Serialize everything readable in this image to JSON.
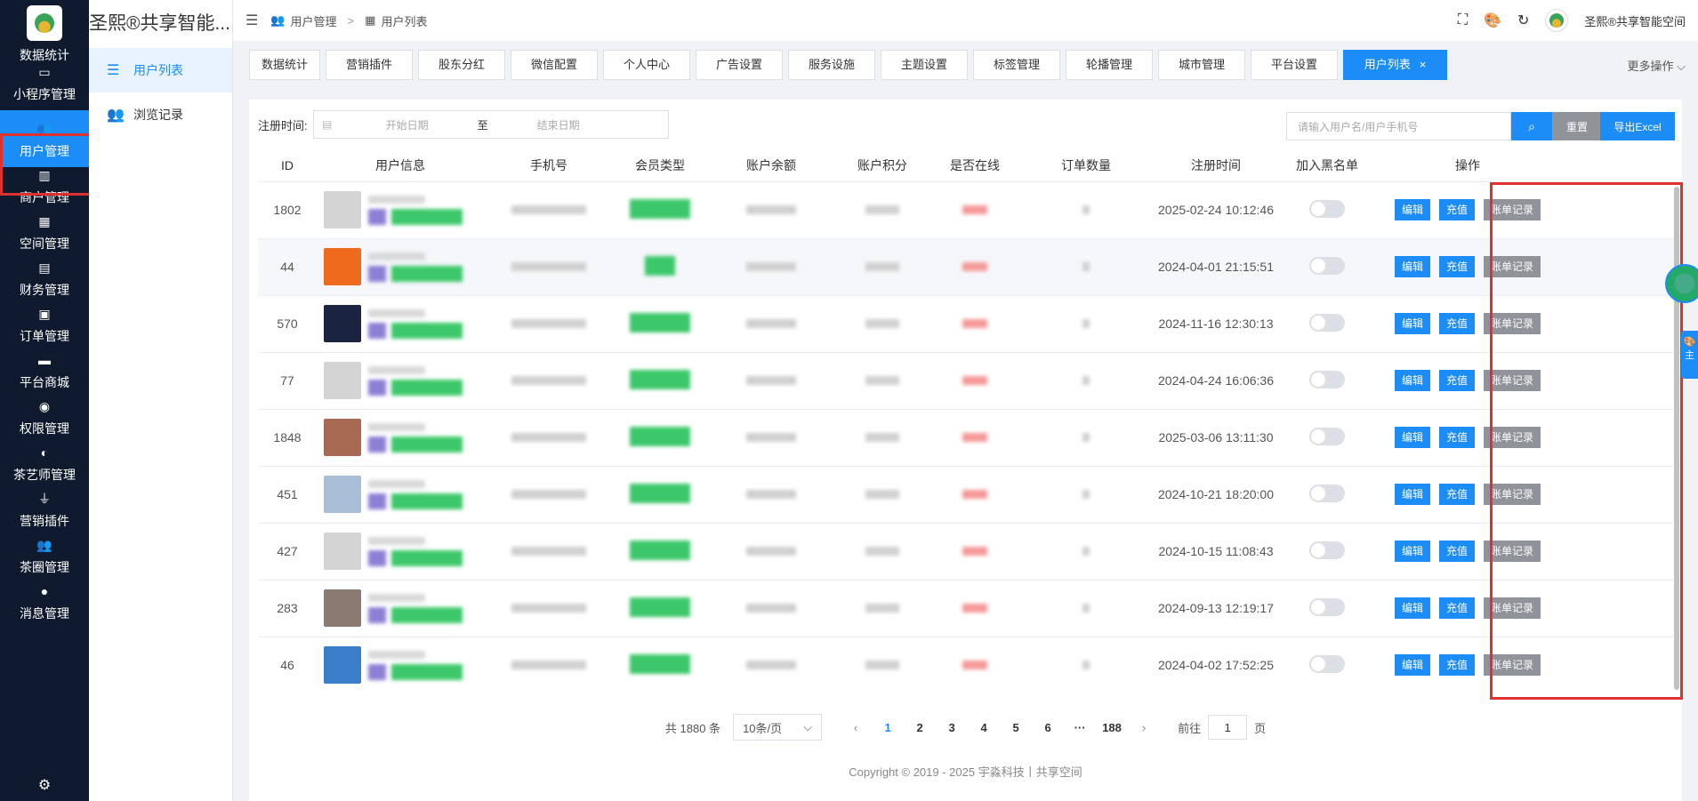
{
  "app_title": "圣熙®共享智能空间",
  "rail": {
    "items": [
      {
        "label": "数据统计",
        "icon": "chart-icon"
      },
      {
        "label": "小程序管理",
        "icon": "monitor-icon"
      },
      {
        "label": "用户管理",
        "icon": "users-icon"
      },
      {
        "label": "商户管理",
        "icon": "building-icon"
      },
      {
        "label": "空间管理",
        "icon": "box-icon"
      },
      {
        "label": "财务管理",
        "icon": "card-icon"
      },
      {
        "label": "订单管理",
        "icon": "clipboard-icon"
      },
      {
        "label": "平台商城",
        "icon": "store-icon"
      },
      {
        "label": "权限管理",
        "icon": "coins-icon"
      },
      {
        "label": "茶艺师管理",
        "icon": "user-cog-icon"
      },
      {
        "label": "营销插件",
        "icon": "plug-icon"
      },
      {
        "label": "茶圈管理",
        "icon": "users-icon"
      },
      {
        "label": "消息管理",
        "icon": "chat-icon"
      }
    ]
  },
  "submenu": {
    "title": "圣熙®共享智能...",
    "items": [
      {
        "label": "用户列表"
      },
      {
        "label": "浏览记录"
      }
    ]
  },
  "topbar": {
    "crumb1": "用户管理",
    "crumb_sep": ">",
    "crumb2": "用户列表",
    "user_name": "圣熙®共享智能空间"
  },
  "tabs": [
    "数据统计",
    "营销插件",
    "股东分红",
    "微信配置",
    "个人中心",
    "广告设置",
    "服务设施",
    "主题设置",
    "标签管理",
    "轮播管理",
    "城市管理",
    "平台设置"
  ],
  "active_tab": "用户列表",
  "active_tab_close": "×",
  "more_ops": "更多操作",
  "filters": {
    "date_label": "注册时间:",
    "start_placeholder": "开始日期",
    "to": "至",
    "end_placeholder": "结束日期",
    "search_placeholder": "请输入用户名/用户手机号",
    "reset": "重置",
    "export": "导出Excel"
  },
  "table": {
    "headers": [
      "ID",
      "用户信息",
      "手机号",
      "会员类型",
      "账户余额",
      "账户积分",
      "是否在线",
      "订单数量",
      "注册时间",
      "加入黑名单",
      "操作"
    ],
    "rows": [
      {
        "id": "1802",
        "time": "2025-02-24 10:12:46",
        "ava": "#d4d4d4"
      },
      {
        "id": "44",
        "time": "2024-04-01 21:15:51",
        "ava": "#f06a1e"
      },
      {
        "id": "570",
        "time": "2024-11-16 12:30:13",
        "ava": "#1a2340"
      },
      {
        "id": "77",
        "time": "2024-04-24 16:06:36",
        "ava": "#d4d4d4"
      },
      {
        "id": "1848",
        "time": "2025-03-06 13:11:30",
        "ava": "#a86a52"
      },
      {
        "id": "451",
        "time": "2024-10-21 18:20:00",
        "ava": "#a9bdd6"
      },
      {
        "id": "427",
        "time": "2024-10-15 11:08:43",
        "ava": "#d4d4d4"
      },
      {
        "id": "283",
        "time": "2024-09-13 12:19:17",
        "ava": "#8b7a70"
      },
      {
        "id": "46",
        "time": "2024-04-02 17:52:25",
        "ava": "#3a7ec9"
      }
    ],
    "op_edit": "编辑",
    "op_charge": "充值",
    "op_bill": "账单记录"
  },
  "pager": {
    "total": "共 1880 条",
    "size": "10条/页",
    "pages": [
      "1",
      "2",
      "3",
      "4",
      "5",
      "6",
      "···",
      "188"
    ],
    "goto_prefix": "前往",
    "goto_value": "1",
    "goto_suffix": "页"
  },
  "footer": "Copyright © 2019 - 2025 宇淼科技丨共享空间",
  "theme_label": "主"
}
